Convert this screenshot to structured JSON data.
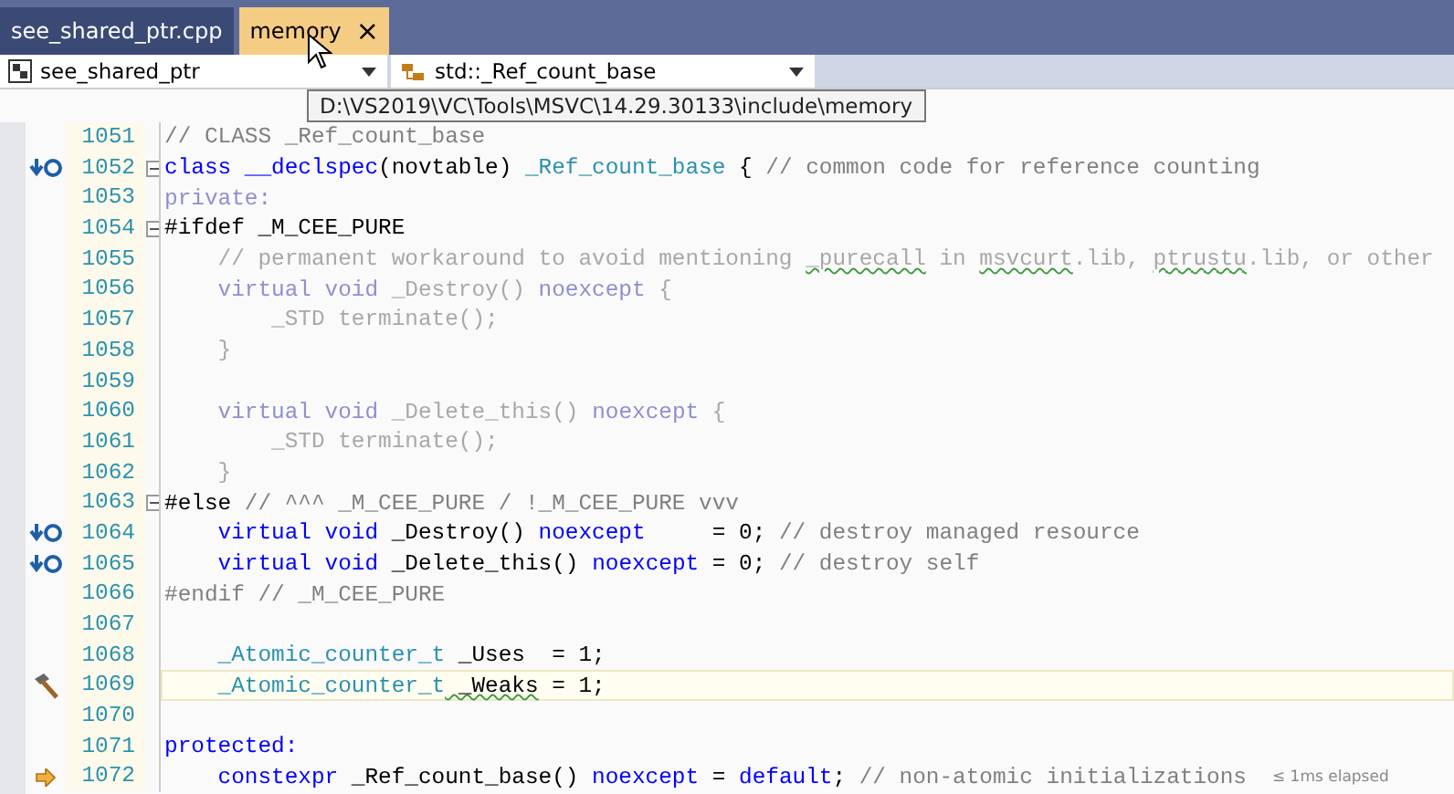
{
  "tabs": [
    {
      "label": "see_shared_ptr.cpp",
      "selected": false
    },
    {
      "label": "memory",
      "selected": true,
      "close": "×"
    }
  ],
  "nav": {
    "project": "see_shared_ptr",
    "scope": "std::_Ref_count_base"
  },
  "tooltip": "D:\\VS2019\\VC\\Tools\\MSVC\\14.29.30133\\include\\memory",
  "lines": [
    {
      "number": "1051",
      "fold": false,
      "current": false,
      "tokens": [
        {
          "t": "// CLASS _Ref_count_base",
          "kind": "comment"
        }
      ]
    },
    {
      "number": "1052",
      "glyph": {
        "kind": "override"
      },
      "fold": true,
      "current": false,
      "tokens": [
        {
          "t": "class ",
          "kind": "kw"
        },
        {
          "t": "__declspec",
          "kind": "kw"
        },
        {
          "t": "(novtable) ",
          "kind": "text"
        },
        {
          "t": "_Ref_count_base",
          "kind": "type"
        },
        {
          "t": " { ",
          "kind": "text"
        },
        {
          "t": "// common code for reference counting",
          "kind": "comment"
        }
      ]
    },
    {
      "number": "1053",
      "fold": false,
      "current": false,
      "tokens": [
        {
          "t": "private:",
          "kind": "dimkw"
        }
      ]
    },
    {
      "number": "1054",
      "fold": true,
      "current": false,
      "tokens": [
        {
          "t": "#ifdef _M_CEE_PURE",
          "kind": "text"
        }
      ]
    },
    {
      "number": "1055",
      "fold": false,
      "current": false,
      "tokens": [
        {
          "t": "    // permanent workaround to avoid mentioning ",
          "kind": "dim"
        },
        {
          "t": "_purecall",
          "kind": "dim",
          "squiggle": true
        },
        {
          "t": " in ",
          "kind": "dim"
        },
        {
          "t": "msvcurt",
          "kind": "dim",
          "squiggle": true
        },
        {
          "t": ".lib, ",
          "kind": "dim"
        },
        {
          "t": "ptrustu",
          "kind": "dim",
          "squiggle": true
        },
        {
          "t": ".lib, or other",
          "kind": "dim"
        }
      ]
    },
    {
      "number": "1056",
      "fold": false,
      "current": false,
      "tokens": [
        {
          "t": "    virtual void",
          "kind": "dimkw"
        },
        {
          "t": " _Destroy() ",
          "kind": "dim"
        },
        {
          "t": "noexcept",
          "kind": "dimkw"
        },
        {
          "t": " {",
          "kind": "dim"
        }
      ]
    },
    {
      "number": "1057",
      "fold": false,
      "current": false,
      "tokens": [
        {
          "t": "        _STD terminate();",
          "kind": "dim"
        }
      ]
    },
    {
      "number": "1058",
      "fold": false,
      "current": false,
      "tokens": [
        {
          "t": "    }",
          "kind": "dim"
        }
      ]
    },
    {
      "number": "1059",
      "fold": false,
      "current": false
    },
    {
      "number": "1060",
      "fold": false,
      "current": false,
      "tokens": [
        {
          "t": "    virtual void",
          "kind": "dimkw"
        },
        {
          "t": " _Delete_this() ",
          "kind": "dim"
        },
        {
          "t": "noexcept",
          "kind": "dimkw"
        },
        {
          "t": " {",
          "kind": "dim"
        }
      ]
    },
    {
      "number": "1061",
      "fold": false,
      "current": false,
      "tokens": [
        {
          "t": "        _STD terminate();",
          "kind": "dim"
        }
      ]
    },
    {
      "number": "1062",
      "fold": false,
      "current": false,
      "tokens": [
        {
          "t": "    }",
          "kind": "dim"
        }
      ]
    },
    {
      "number": "1063",
      "fold": true,
      "current": false,
      "tokens": [
        {
          "t": "#else",
          "kind": "text"
        },
        {
          "t": " // ^^^ _M_CEE_PURE / !_M_CEE_PURE vvv",
          "kind": "comment"
        }
      ]
    },
    {
      "number": "1064",
      "glyph": {
        "kind": "override"
      },
      "fold": false,
      "current": false,
      "tokens": [
        {
          "t": "    virtual void",
          "kind": "kw"
        },
        {
          "t": " _Destroy() ",
          "kind": "text"
        },
        {
          "t": "noexcept",
          "kind": "kw"
        },
        {
          "t": "     = 0; ",
          "kind": "text"
        },
        {
          "t": "// destroy managed resource",
          "kind": "comment"
        }
      ]
    },
    {
      "number": "1065",
      "glyph": {
        "kind": "override"
      },
      "fold": false,
      "current": false,
      "tokens": [
        {
          "t": "    virtual void",
          "kind": "kw"
        },
        {
          "t": " _Delete_this() ",
          "kind": "text"
        },
        {
          "t": "noexcept",
          "kind": "kw"
        },
        {
          "t": " = 0; ",
          "kind": "text"
        },
        {
          "t": "// destroy self",
          "kind": "comment"
        }
      ]
    },
    {
      "number": "1066",
      "fold": false,
      "current": false,
      "tokens": [
        {
          "t": "#endif // _M_CEE_PURE",
          "kind": "comment"
        }
      ]
    },
    {
      "number": "1067",
      "fold": false,
      "current": false
    },
    {
      "number": "1068",
      "fold": false,
      "current": false,
      "tokens": [
        {
          "t": "    _Atomic_counter_t",
          "kind": "type"
        },
        {
          "t": " _Uses  = 1;",
          "kind": "text"
        }
      ]
    },
    {
      "number": "1069",
      "glyph": {
        "kind": "hammer"
      },
      "fold": false,
      "current": true,
      "tokens": [
        {
          "t": "    _Atomic_counter_t",
          "kind": "type"
        },
        {
          "t": " _Weaks",
          "kind": "text",
          "squiggle": true
        },
        {
          "t": " = 1;",
          "kind": "text"
        }
      ]
    },
    {
      "number": "1070",
      "fold": false,
      "current": false
    },
    {
      "number": "1071",
      "fold": false,
      "current": false,
      "tokens": [
        {
          "t": "protected:",
          "kind": "kw"
        }
      ]
    },
    {
      "number": "1072",
      "glyph": {
        "kind": "arrow"
      },
      "fold": false,
      "current": false,
      "tokens": [
        {
          "t": "    constexpr",
          "kind": "kw"
        },
        {
          "t": " _Ref_count_base() ",
          "kind": "text"
        },
        {
          "t": "noexcept",
          "kind": "kw"
        },
        {
          "t": " = ",
          "kind": "text"
        },
        {
          "t": "default",
          "kind": "kw"
        },
        {
          "t": "; ",
          "kind": "text"
        },
        {
          "t": "// non-atomic initializations",
          "kind": "comment"
        }
      ],
      "note": "≤ 1ms elapsed"
    }
  ]
}
